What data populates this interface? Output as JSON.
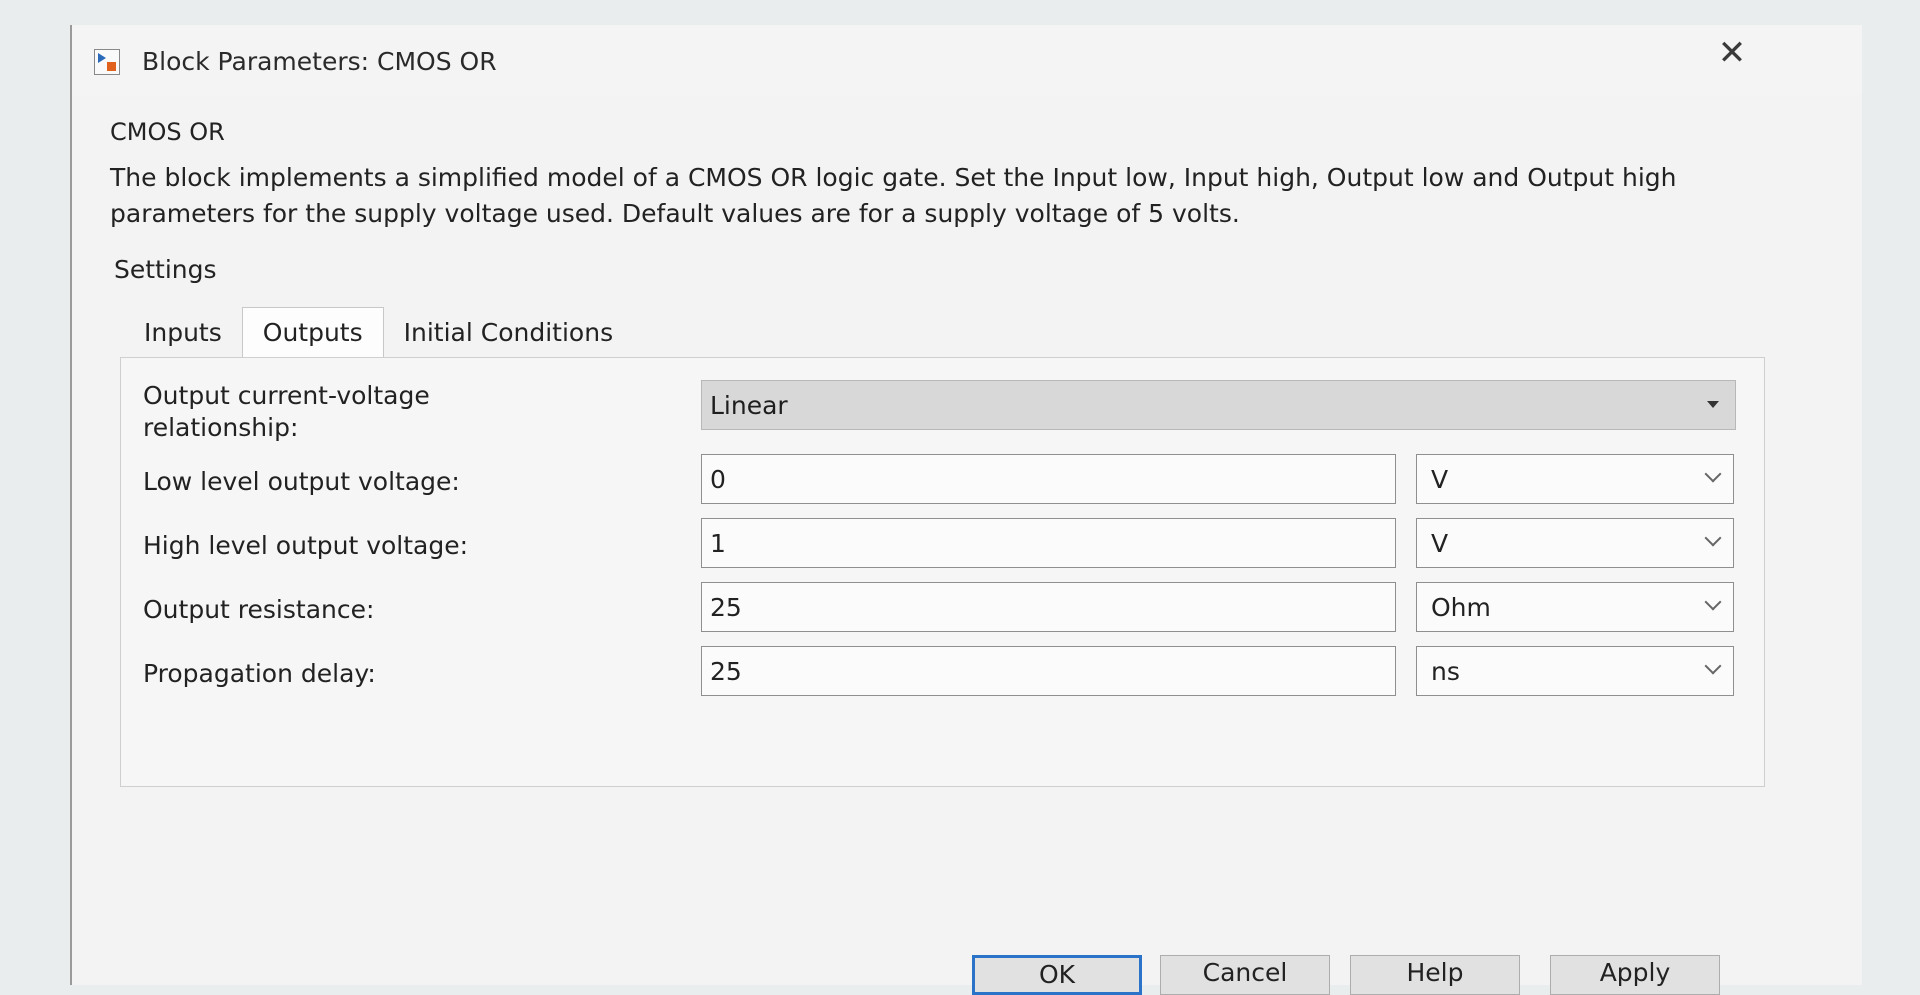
{
  "window": {
    "title": "Block Parameters: CMOS OR",
    "close_symbol": "✕"
  },
  "block": {
    "name": "CMOS OR",
    "description": "The block implements a simplified model of a CMOS OR logic gate. Set the Input low, Input high, Output low and Output high parameters for the supply voltage used. Default values are for a supply voltage of 5 volts."
  },
  "settings": {
    "label": "Settings",
    "tabs": [
      {
        "label": "Inputs",
        "active": false
      },
      {
        "label": "Outputs",
        "active": true
      },
      {
        "label": "Initial Conditions",
        "active": false
      }
    ]
  },
  "outputs": {
    "iv_relationship": {
      "label_line1": "Output current-voltage",
      "label_line2": "relationship:",
      "value": "Linear"
    },
    "fields": [
      {
        "label": "Low level output voltage:",
        "value": "0",
        "unit": "V"
      },
      {
        "label": "High level output voltage:",
        "value": "1",
        "unit": "V"
      },
      {
        "label": "Output resistance:",
        "value": "25",
        "unit": "Ohm"
      },
      {
        "label": "Propagation delay:",
        "value": "25",
        "unit": "ns"
      }
    ]
  },
  "buttons": {
    "ok": "OK",
    "cancel": "Cancel",
    "help": "Help",
    "apply": "Apply"
  },
  "icons": {
    "app": "simulink-block-icon",
    "close": "close-icon",
    "dropdown": "caret-down-icon",
    "unit_dropdown": "chevron-down-icon"
  }
}
